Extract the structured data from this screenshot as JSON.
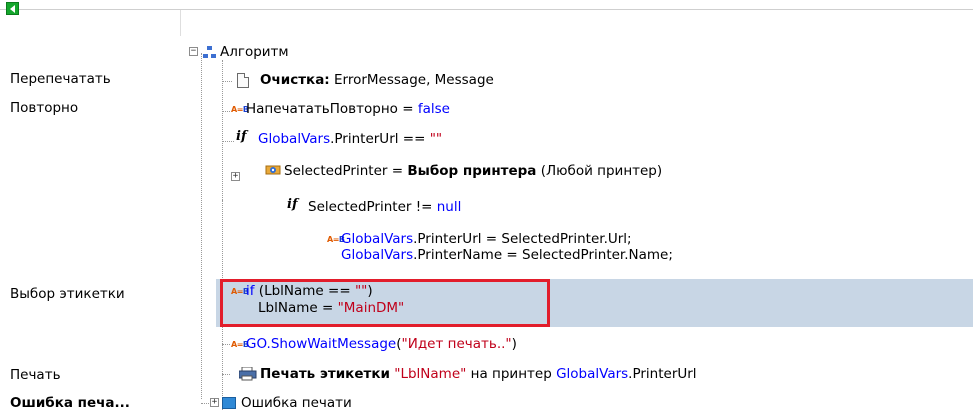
{
  "window": {
    "back_button_icon": "back-arrow-icon"
  },
  "steps": {
    "reprint": "Перепечатать",
    "repeat": "Повторно",
    "label_select": "Выбор этикетки",
    "print": "Печать",
    "print_error": "Ошибка печа..."
  },
  "tree": {
    "root_label": "Алгоритм",
    "clear": {
      "title": "Очистка:",
      "args": "ErrorMessage, Message"
    },
    "assign_reprint": {
      "var": "НапечататьПовторно",
      "op": " = ",
      "value": "false"
    },
    "if_url": {
      "obj": "GlobalVars",
      "prop": ".PrinterUrl == ",
      "value": "\"\""
    },
    "select_printer": {
      "var": "SelectedPrinter = ",
      "action": "Выбор принтера",
      "args": " (Любой принтер)"
    },
    "if_not_null": {
      "expr": "SelectedPrinter != ",
      "value": "null"
    },
    "set_url": {
      "line1_obj": "GlobalVars",
      "line1_rest": ".PrinterUrl = SelectedPrinter.Url;",
      "line2_obj": "GlobalVars",
      "line2_rest": ".PrinterName = SelectedPrinter.Name;"
    },
    "lbl_check": {
      "if_kw": "if",
      "cond": " (LblName == ",
      "cond_val": "\"\"",
      "cond_close": ")",
      "assign": "LblName = ",
      "assign_val": "\"MainDM\""
    },
    "wait_msg": {
      "obj": "GO",
      "method": ".ShowWaitMessage",
      "open": "(",
      "value": "\"Идет печать..\"",
      "close": ")"
    },
    "print_label": {
      "title": "Печать этикетки",
      "value": " \"LblName\"",
      "middle": " на принтер ",
      "obj": "GlobalVars",
      "prop": ".PrinterUrl"
    },
    "print_error": "Ошибка печати"
  },
  "colors": {
    "keyword": "#0000ff",
    "string": "#c0001a",
    "selection": "#c8d6e5",
    "highlight_border": "#e21d2b"
  }
}
